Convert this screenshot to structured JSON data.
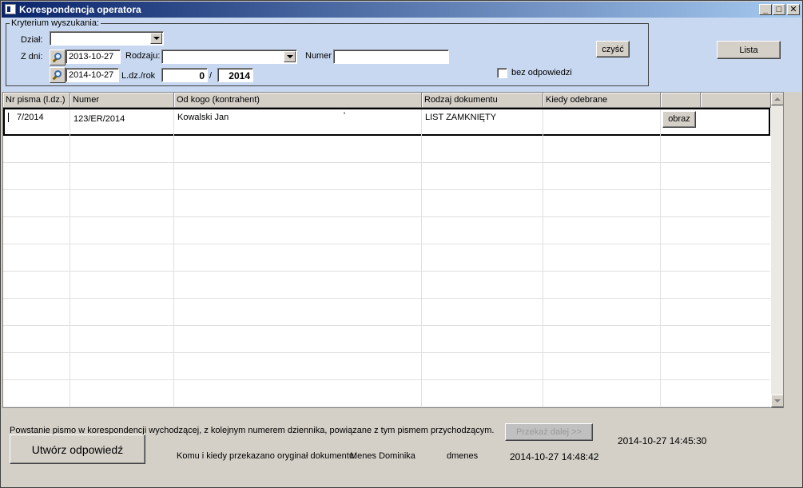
{
  "window": {
    "title": "Korespondencja operatora",
    "minimize": "_",
    "maximize": "□",
    "close": "✕"
  },
  "criteria": {
    "legend": "Kryterium wyszukania:",
    "dzial_label": "Dział:",
    "dzial_value": "",
    "zdni_label": "Z dni:",
    "date_from": "2013-10-27",
    "date_to": "2014-10-27",
    "rodzaju_label": "Rodzaju:",
    "rodzaju_value": "",
    "numer_label": "Numer",
    "numer_value": "",
    "ldz_label": "L.dz./rok",
    "ldz_number": "0",
    "ldz_sep": "/",
    "ldz_year": "2014",
    "clear_button": "czyść",
    "no_reply_label": "bez odpowiedzi",
    "no_reply_checked": false
  },
  "list_button": "Lista",
  "table": {
    "columns": [
      "Nr pisma (l.dz.)",
      "Numer",
      "Od kogo (kontrahent)",
      "Rodzaj dokumentu",
      "Kiedy odebrane",
      ""
    ],
    "rows": [
      {
        "nr": "7/2014",
        "numer": "123/ER/2014",
        "od_kogo": "Kowalski Jan",
        "tick": "'",
        "rodzaj": "LIST ZAMKNIĘTY",
        "kiedy": "",
        "action": "obraz"
      }
    ]
  },
  "footer": {
    "info_text": "Powstanie pismo w korespondencji wychodzącej, z kolejnym numerem dziennika, powiązane z tym pismem przychodzącym.",
    "reply_button": "Utwórz odpowiedź",
    "forward_button": "Przekaż dalej >>",
    "forward_timestamp": "2014-10-27 14:45:30",
    "original_label": "Komu i kiedy przekazano oryginał dokumentu:",
    "recipient_name": "Menes Dominika",
    "recipient_login": "dmenes",
    "handover_timestamp": "2014-10-27 14:48:42"
  }
}
